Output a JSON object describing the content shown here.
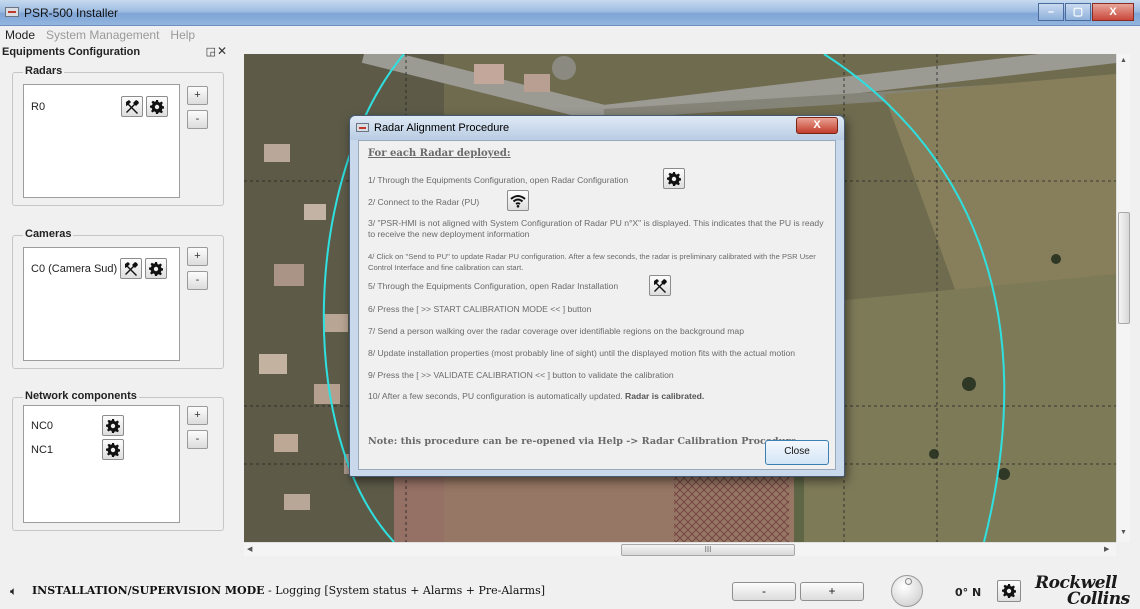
{
  "window": {
    "title": "PSR-500 Installer",
    "minimize": "–",
    "maximize": "▢",
    "close": "X"
  },
  "menu": [
    {
      "label": "Mode",
      "enabled": true
    },
    {
      "label": "System Management",
      "enabled": false
    },
    {
      "label": "Help",
      "enabled": false
    }
  ],
  "dock": {
    "title": "Equipments Configuration",
    "radars": {
      "title": "Radars",
      "items": [
        {
          "label": "R0"
        }
      ],
      "add": "+",
      "remove": "-"
    },
    "cameras": {
      "title": "Cameras",
      "items": [
        {
          "label": "C0 (Camera Sud)"
        }
      ],
      "add": "+",
      "remove": "-"
    },
    "network": {
      "title": "Network components",
      "items": [
        {
          "label": "NC0"
        },
        {
          "label": "NC1"
        }
      ],
      "add": "+",
      "remove": "-"
    }
  },
  "map": {
    "hscroll_thumb": "III",
    "vscroll_thumb": "≡"
  },
  "dialog": {
    "title": "Radar Alignment Procedure",
    "close_x": "X",
    "heading": "For each Radar deployed:",
    "step1": "1/ Through the Equipments Configuration, open Radar Configuration",
    "step2": "2/ Connect to the Radar (PU)",
    "step3": "3/ \"PSR-HMI is not aligned with System Configuration of Radar PU n°X\" is displayed. This indicates that the PU is ready to receive the new deployment information",
    "step4": "4/ Click on \"Send to PU\" to update Radar PU configuration. After a few seconds, the radar is preliminary calibrated with the PSR User Control Interface and fine calibration can start.",
    "step5": "5/ Through the Equipments Configuration, open Radar Installation",
    "step6": "6/ Press the [ >> START CALIBRATION MODE << ] button",
    "step7": "7/ Send a person walking over the radar coverage over identifiable regions on the background map",
    "step8": "8/ Update installation properties (most probably line of sight) until the displayed motion fits with the actual motion",
    "step9": "9/ Press the [ >> VALIDATE CALIBRATION << ] button to validate the calibration",
    "step10_a": "10/ After a few seconds, PU configuration is automatically updated. ",
    "step10_b": "Radar is calibrated.",
    "note": "Note: this procedure can be re-opened via Help -> Radar Calibration Procedure ...",
    "close_button": "Close"
  },
  "status": {
    "mode": "INSTALLATION/SUPERVISION MODE",
    "logging": " - Logging [System status + Alarms + Pre-Alarms]",
    "zoom_out": "-",
    "zoom_in": "+",
    "heading": "0° N"
  },
  "logo": {
    "line1": "Rockwell",
    "line2": "Collins"
  },
  "colors": {
    "coverage": "#2ee0e0",
    "restricted_zone": "#d98a8a"
  }
}
